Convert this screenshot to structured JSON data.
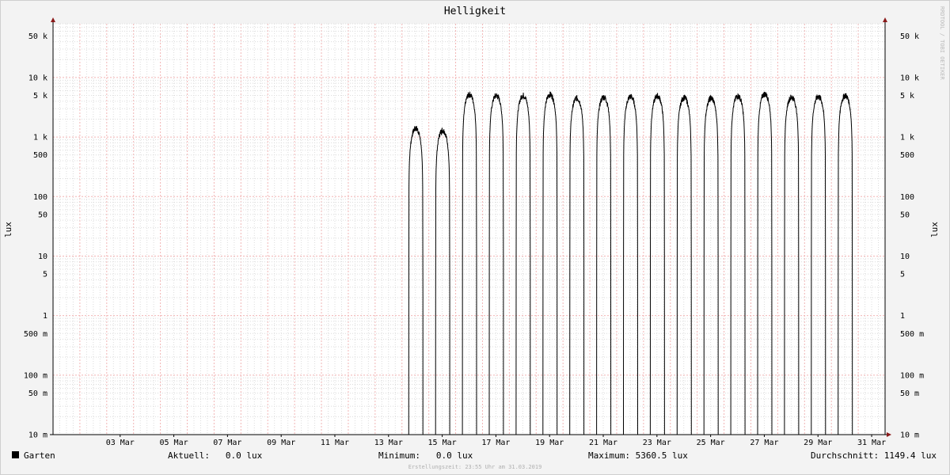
{
  "chart_data": {
    "type": "line",
    "title": "Helligkeit",
    "ylabel": "lux",
    "y_scale": "log",
    "ylim": [
      0.01,
      80000
    ],
    "xlim": [
      "2019-03-01",
      "2019-04-01"
    ],
    "grid": true,
    "x_tick_labels": [
      "03 Mar",
      "05 Mar",
      "07 Mar",
      "09 Mar",
      "11 Mar",
      "13 Mar",
      "15 Mar",
      "17 Mar",
      "19 Mar",
      "21 Mar",
      "23 Mar",
      "25 Mar",
      "27 Mar",
      "29 Mar",
      "31 Mar"
    ],
    "y_ticks": [
      {
        "value": 0.01,
        "label": "10 m"
      },
      {
        "value": 0.05,
        "label": "50 m"
      },
      {
        "value": 0.1,
        "label": "100 m"
      },
      {
        "value": 0.5,
        "label": "500 m"
      },
      {
        "value": 1,
        "label": "1"
      },
      {
        "value": 5,
        "label": "5"
      },
      {
        "value": 10,
        "label": "10"
      },
      {
        "value": 50,
        "label": "50"
      },
      {
        "value": 100,
        "label": "100"
      },
      {
        "value": 500,
        "label": "500"
      },
      {
        "value": 1000,
        "label": "1 k"
      },
      {
        "value": 5000,
        "label": "5 k"
      },
      {
        "value": 10000,
        "label": "10 k"
      },
      {
        "value": 50000,
        "label": "50 k"
      }
    ],
    "series": [
      {
        "name": "Garten",
        "color": "#000000",
        "daily_peaks_lux": [
          {
            "date": "2019-03-14",
            "peak": 1400
          },
          {
            "date": "2019-03-15",
            "peak": 1300
          },
          {
            "date": "2019-03-16",
            "peak": 5200
          },
          {
            "date": "2019-03-17",
            "peak": 5000
          },
          {
            "date": "2019-03-18",
            "peak": 5000
          },
          {
            "date": "2019-03-19",
            "peak": 5200
          },
          {
            "date": "2019-03-20",
            "peak": 4500
          },
          {
            "date": "2019-03-21",
            "peak": 4700
          },
          {
            "date": "2019-03-22",
            "peak": 4800
          },
          {
            "date": "2019-03-23",
            "peak": 4900
          },
          {
            "date": "2019-03-24",
            "peak": 4600
          },
          {
            "date": "2019-03-25",
            "peak": 4500
          },
          {
            "date": "2019-03-26",
            "peak": 4900
          },
          {
            "date": "2019-03-27",
            "peak": 5300
          },
          {
            "date": "2019-03-28",
            "peak": 4700
          },
          {
            "date": "2019-03-29",
            "peak": 4800
          },
          {
            "date": "2019-03-30",
            "peak": 5000
          }
        ]
      }
    ]
  },
  "watermark": "RRDTOOL / TOBI OETIKER",
  "legend": {
    "name": "Garten",
    "color": "#000000",
    "current": "Aktuell:   0.0 lux",
    "minimum": "Minimum:   0.0 lux",
    "maximum": "Maximum: 5360.5 lux",
    "average": "Durchschnitt: 1149.4 lux"
  },
  "footer": "Erstellungszeit: 23:55 Uhr am 31.03.2019"
}
